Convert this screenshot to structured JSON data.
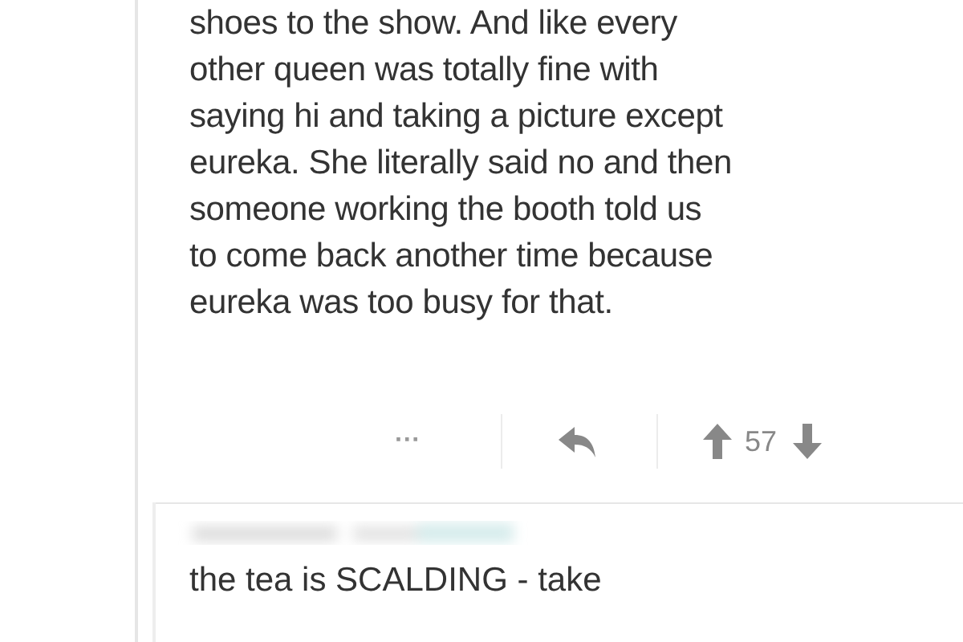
{
  "comment": {
    "body_lines": [
      "shoes to the show. And like every",
      "other queen was totally fine with",
      "saying hi and taking a picture except",
      "eureka. She literally said no and then",
      "someone working the booth told us",
      "to come back another time because",
      "eureka was too busy for that."
    ],
    "actions": {
      "more": "···",
      "score": "57"
    }
  },
  "reply": {
    "body": "the tea is SCALDING - take"
  }
}
